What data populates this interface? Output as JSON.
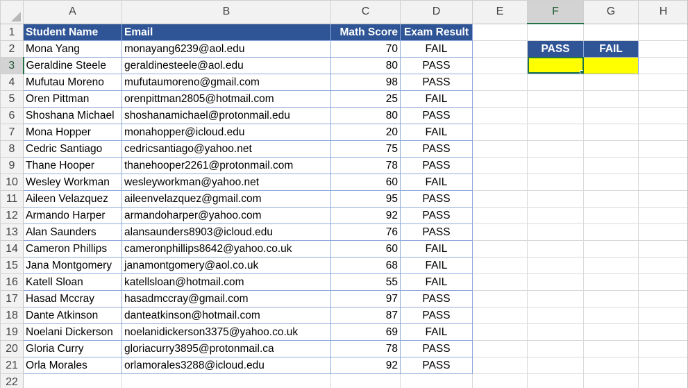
{
  "columns": [
    "A",
    "B",
    "C",
    "D",
    "E",
    "F",
    "G",
    "H"
  ],
  "selected_column": "F",
  "selected_row": "3",
  "table": {
    "headers": [
      "Student Name",
      "Email",
      "Math Score",
      "Exam Result"
    ],
    "rows": [
      [
        "Mona Yang",
        "monayang6239@aol.edu",
        "70",
        "FAIL"
      ],
      [
        "Geraldine Steele",
        "geraldinesteele@aol.edu",
        "80",
        "PASS"
      ],
      [
        "Mufutau Moreno",
        "mufutaumoreno@gmail.com",
        "98",
        "PASS"
      ],
      [
        "Oren Pittman",
        "orenpittman2805@hotmail.com",
        "25",
        "FAIL"
      ],
      [
        "Shoshana Michael",
        "shoshanamichael@protonmail.edu",
        "80",
        "PASS"
      ],
      [
        "Mona Hopper",
        "monahopper@icloud.edu",
        "20",
        "FAIL"
      ],
      [
        "Cedric Santiago",
        "cedricsantiago@yahoo.net",
        "75",
        "PASS"
      ],
      [
        "Thane Hooper",
        "thanehooper2261@protonmail.com",
        "78",
        "PASS"
      ],
      [
        "Wesley Workman",
        "wesleyworkman@yahoo.net",
        "60",
        "FAIL"
      ],
      [
        "Aileen Velazquez",
        "aileenvelazquez@gmail.com",
        "95",
        "PASS"
      ],
      [
        "Armando Harper",
        "armandoharper@yahoo.com",
        "92",
        "PASS"
      ],
      [
        "Alan Saunders",
        "alansaunders8903@icloud.edu",
        "76",
        "PASS"
      ],
      [
        "Cameron Phillips",
        "cameronphillips8642@yahoo.co.uk",
        "60",
        "FAIL"
      ],
      [
        "Jana Montgomery",
        "janamontgomery@aol.co.uk",
        "68",
        "FAIL"
      ],
      [
        "Katell Sloan",
        "katellsloan@hotmail.com",
        "55",
        "FAIL"
      ],
      [
        "Hasad Mccray",
        "hasadmccray@gmail.com",
        "97",
        "PASS"
      ],
      [
        "Dante Atkinson",
        "danteatkinson@hotmail.com",
        "87",
        "PASS"
      ],
      [
        "Noelani Dickerson",
        "noelanidickerson3375@yahoo.co.uk",
        "69",
        "FAIL"
      ],
      [
        "Gloria Curry",
        "gloriacurry3895@protonmail.ca",
        "78",
        "PASS"
      ],
      [
        "Orla Morales",
        "orlamorales3288@icloud.edu",
        "92",
        "PASS"
      ]
    ]
  },
  "summary": {
    "pass_label": "PASS",
    "fail_label": "FAIL"
  },
  "colors": {
    "header_fill": "#2f5597",
    "highlight_fill": "#ffff00",
    "selection_accent": "#217346"
  },
  "icons": {
    "corner": "select-all-triangle-icon"
  }
}
